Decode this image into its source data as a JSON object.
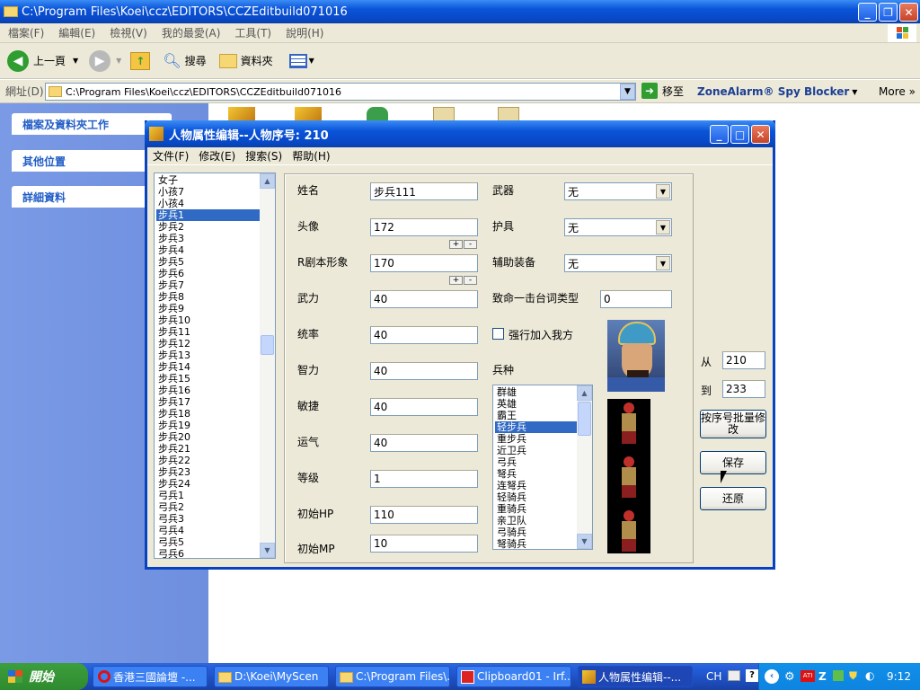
{
  "explorer": {
    "title": "C:\\Program Files\\Koei\\ccz\\EDITORS\\CCZEditbuild071016",
    "menu": [
      "檔案(F)",
      "編輯(E)",
      "檢視(V)",
      "我的最愛(A)",
      "工具(T)",
      "說明(H)"
    ],
    "toolbar": {
      "back": "上一頁",
      "search": "搜尋",
      "folders": "資料夾"
    },
    "address_label": "網址(D)",
    "address_value": "C:\\Program Files\\Koei\\ccz\\EDITORS\\CCZEditbuild071016",
    "go_label": "移至",
    "zonealarm": "ZoneAlarm® Spy Blocker",
    "more": "More",
    "sidebar": [
      "檔案及資料夾工作",
      "其他位置",
      "詳細資料"
    ]
  },
  "dialog": {
    "title": "人物属性编辑--人物序号: 210",
    "menu": [
      "文件(F)",
      "修改(E)",
      "搜索(S)",
      "帮助(H)"
    ],
    "name_list": [
      "女子",
      "小孩7",
      "小孩4",
      "步兵1",
      "步兵2",
      "步兵3",
      "步兵4",
      "步兵5",
      "步兵6",
      "步兵7",
      "步兵8",
      "步兵9",
      "步兵10",
      "步兵11",
      "步兵12",
      "步兵13",
      "步兵14",
      "步兵15",
      "步兵16",
      "步兵17",
      "步兵18",
      "步兵19",
      "步兵20",
      "步兵21",
      "步兵22",
      "步兵23",
      "步兵24",
      "弓兵1",
      "弓兵2",
      "弓兵3",
      "弓兵4",
      "弓兵5",
      "弓兵6"
    ],
    "name_selected": 3,
    "fields": {
      "name_label": "姓名",
      "name_value": "步兵111",
      "face_label": "头像",
      "face_value": "172",
      "r_label": "R剧本形象",
      "r_value": "170",
      "power_label": "武力",
      "power_value": "40",
      "lead_label": "统率",
      "lead_value": "40",
      "int_label": "智力",
      "int_value": "40",
      "agi_label": "敏捷",
      "agi_value": "40",
      "luck_label": "运气",
      "luck_value": "40",
      "level_label": "等级",
      "level_value": "1",
      "hp_label": "初始HP",
      "hp_value": "110",
      "mp_label": "初始MP",
      "mp_value": "10"
    },
    "plus": "+",
    "minus": "-",
    "right": {
      "weapon_label": "武器",
      "weapon_value": "无",
      "armor_label": "护具",
      "armor_value": "无",
      "aux_label": "辅助装备",
      "aux_value": "无",
      "crit_label": "致命一击台词类型",
      "crit_value": "0",
      "force_join_label": "强行加入我方",
      "force_join_checked": false,
      "troop_label": "兵种"
    },
    "troop_list": [
      "群雄",
      "英雄",
      "霸王",
      "轻步兵",
      "重步兵",
      "近卫兵",
      "弓兵",
      "弩兵",
      "连弩兵",
      "轻骑兵",
      "重骑兵",
      "亲卫队",
      "弓骑兵",
      "弩骑兵"
    ],
    "troop_selected": 3,
    "batch": {
      "from_label": "从",
      "from_value": "210",
      "to_label": "到",
      "to_value": "233",
      "batch_button": "按序号批量修改"
    },
    "save_button": "保存",
    "restore_button": "还原"
  },
  "taskbar": {
    "start": "開始",
    "tasks": [
      "香港三國論壇 -...",
      "D:\\Koei\\MyScen",
      "C:\\Program Files\\...",
      "Clipboard01 - Irf...",
      "人物属性编辑--..."
    ],
    "active_task": 4,
    "lang": "CH",
    "time": "9:12"
  }
}
